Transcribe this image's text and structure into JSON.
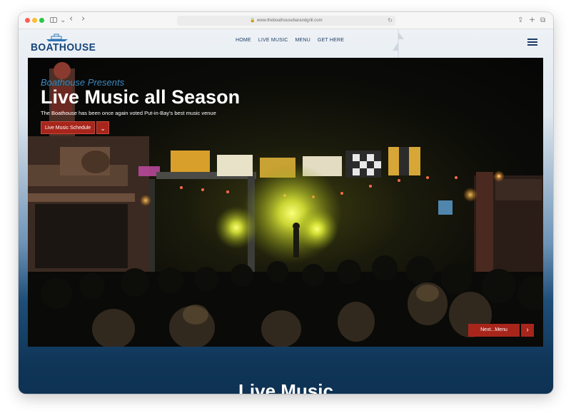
{
  "browser": {
    "url": "www.theboathousebarandgrill.com",
    "nav_back": "‹",
    "nav_forward": "›",
    "tab_caret": "⌄",
    "share_icon": "⇪",
    "new_tab_icon": "+",
    "tabs_icon": "⧉",
    "reload_icon": "↻",
    "lock_icon": "🔒"
  },
  "header": {
    "logo_text": "BOATHOUSE",
    "nav": [
      "HOME",
      "LIVE MUSIC",
      "MENU",
      "GET HERE"
    ]
  },
  "hero": {
    "overline": "Boathouse Presents",
    "title": "Live Music all Season",
    "subtitle": "The Boathouse has been once again voted Put-in-Bay's best music venue",
    "cta_label": "Live Music Schedule",
    "cta_chevron": "⌄",
    "next_label": "Next...Menu",
    "next_chevron": "›"
  },
  "section": {
    "heading": "Live Music"
  },
  "colors": {
    "brand_blue": "#17457a",
    "accent_red": "#a8251b",
    "overline_blue": "#3a88c0",
    "footer_navy": "#0e3253"
  }
}
